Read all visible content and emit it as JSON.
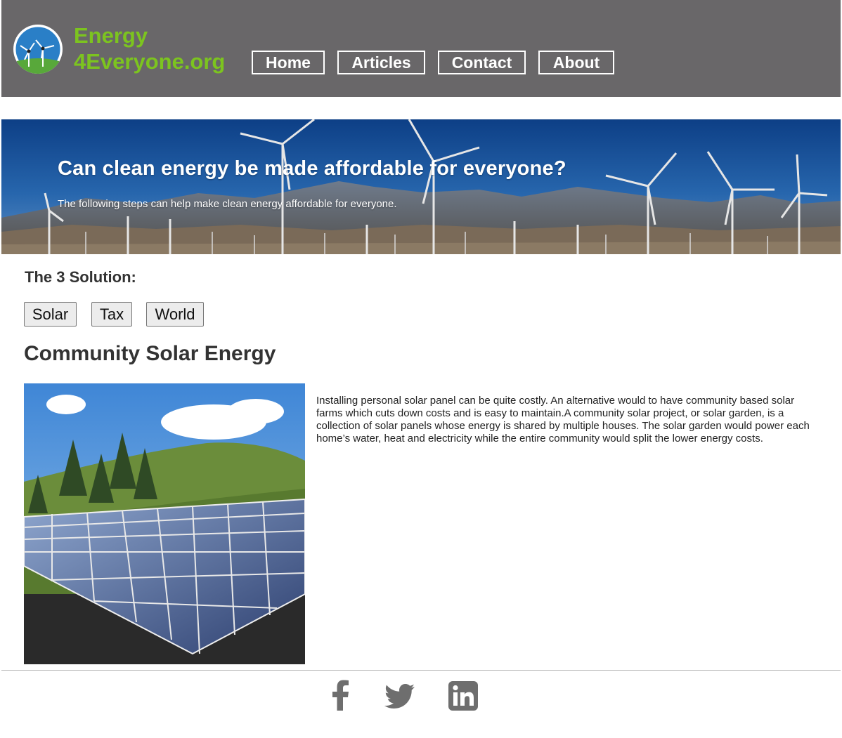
{
  "header": {
    "brand_line1": "Energy",
    "brand_line2": "4Everyone.org",
    "brand_color": "#7cc41f",
    "background": "#696769",
    "logo_icon": "wind-turbine-icon",
    "nav": [
      {
        "label": "Home"
      },
      {
        "label": "Articles"
      },
      {
        "label": "Contact"
      },
      {
        "label": "About"
      }
    ]
  },
  "hero": {
    "title": "Can clean energy be made affordable for everyone?",
    "subtitle": "The following steps can help make clean energy affordable for everyone.",
    "image": "wind-farm-mountains-photo"
  },
  "solutions": {
    "heading": "The 3 Solution:",
    "tabs": [
      {
        "label": "Solar"
      },
      {
        "label": "Tax"
      },
      {
        "label": "World"
      }
    ]
  },
  "content": {
    "title": "Community Solar Energy",
    "image": "solar-panel-array-photo",
    "body": "Installing personal solar panel can be quite costly. An alternative would to have community based solar farms which cuts down costs and is easy to maintain.A community solar project, or solar garden, is a collection of solar panels whose energy is shared by multiple houses. The solar garden would power each home’s water, heat and electricity while the entire community would split the lower energy costs."
  },
  "footer": {
    "social": [
      {
        "icon": "facebook-icon"
      },
      {
        "icon": "twitter-icon"
      },
      {
        "icon": "linkedin-icon"
      }
    ],
    "icon_color": "#6e6e6e"
  }
}
